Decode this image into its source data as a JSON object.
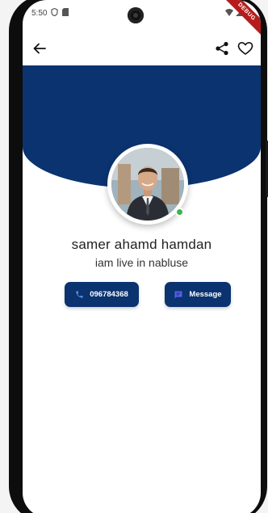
{
  "status_bar": {
    "time": "5:50"
  },
  "debug_banner": "DEBUG",
  "profile": {
    "name": "samer ahamd hamdan",
    "bio": "iam live in nabluse",
    "online": true
  },
  "actions": {
    "call_label": "096784368",
    "message_label": "Message"
  },
  "colors": {
    "primary": "#0a3370",
    "online": "#3bb54a",
    "debug_ribbon": "#b71c1c"
  },
  "icons": {
    "back": "arrow-back-icon",
    "share": "share-icon",
    "favorite": "heart-outline-icon",
    "call": "phone-icon",
    "message": "chat-bubble-icon"
  }
}
